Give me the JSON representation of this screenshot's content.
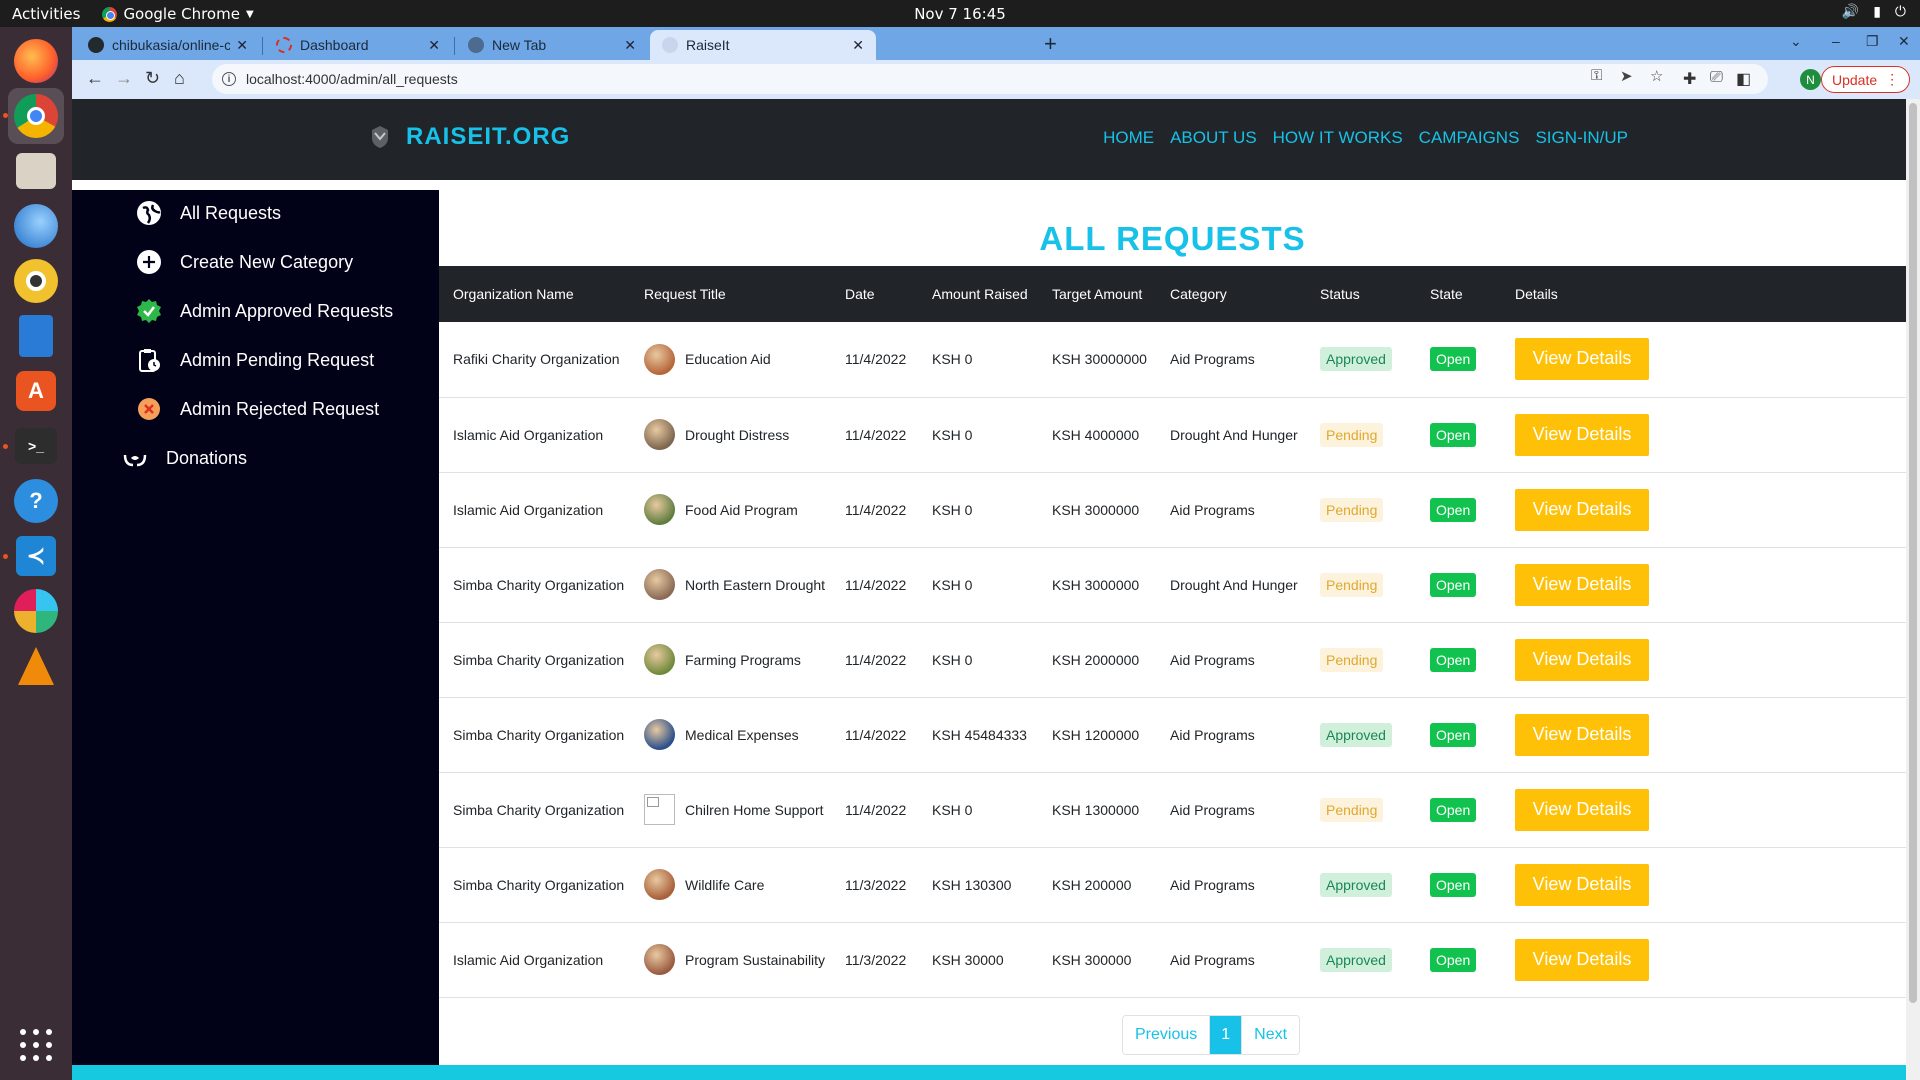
{
  "os_bar": {
    "activities": "Activities",
    "app_name": "Google Chrome",
    "clock": "Nov 7  16:45"
  },
  "browser": {
    "tabs": [
      {
        "title": "chibukasia/online-charity"
      },
      {
        "title": "Dashboard"
      },
      {
        "title": "New Tab"
      },
      {
        "title": "RaiseIt"
      }
    ],
    "active_tab_index": 3,
    "url": "localhost:4000/admin/all_requests",
    "profile_initial": "N",
    "update_label": "Update"
  },
  "site": {
    "brand": "RAISEIT.ORG",
    "nav": [
      "HOME",
      "ABOUT US",
      "HOW IT WORKS",
      "CAMPAIGNS",
      "SIGN-IN/UP"
    ]
  },
  "sidebar": {
    "items": [
      {
        "label": "All Requests",
        "icon": "globe-icon"
      },
      {
        "label": "Create New Category",
        "icon": "plus-circle-icon"
      },
      {
        "label": "Admin Approved Requests",
        "icon": "check-badge-icon"
      },
      {
        "label": "Admin Pending Request",
        "icon": "clipboard-clock-icon"
      },
      {
        "label": "Admin Rejected Request",
        "icon": "x-circle-icon"
      },
      {
        "label": "Donations",
        "icon": "donation-hands-icon"
      }
    ]
  },
  "main": {
    "title": "ALL REQUESTS",
    "columns": [
      "Organization Name",
      "Request Title",
      "Date",
      "Amount Raised",
      "Target Amount",
      "Category",
      "Status",
      "State",
      "Details"
    ],
    "rows": [
      {
        "org": "Rafiki Charity Organization",
        "title": "Education Aid",
        "date": "11/4/2022",
        "raised": "KSH 0",
        "target": "KSH 30000000",
        "category": "Aid Programs",
        "status": "Approved",
        "state": "Open",
        "action": "View Details",
        "img_color": "#b5653a"
      },
      {
        "org": "Islamic Aid Organization",
        "title": "Drought Distress",
        "date": "11/4/2022",
        "raised": "KSH 0",
        "target": "KSH 4000000",
        "category": "Drought And Hunger",
        "status": "Pending",
        "state": "Open",
        "action": "View Details",
        "img_color": "#7d6650"
      },
      {
        "org": "Islamic Aid Organization",
        "title": "Food Aid Program",
        "date": "11/4/2022",
        "raised": "KSH 0",
        "target": "KSH 3000000",
        "category": "Aid Programs",
        "status": "Pending",
        "state": "Open",
        "action": "View Details",
        "img_color": "#5f7d3f"
      },
      {
        "org": "Simba Charity Organization",
        "title": "North Eastern Drought",
        "date": "11/4/2022",
        "raised": "KSH 0",
        "target": "KSH 3000000",
        "category": "Drought And Hunger",
        "status": "Pending",
        "state": "Open",
        "action": "View Details",
        "img_color": "#8a6a55"
      },
      {
        "org": "Simba Charity Organization",
        "title": "Farming Programs",
        "date": "11/4/2022",
        "raised": "KSH 0",
        "target": "KSH 2000000",
        "category": "Aid Programs",
        "status": "Pending",
        "state": "Open",
        "action": "View Details",
        "img_color": "#6f8a3a"
      },
      {
        "org": "Simba Charity Organization",
        "title": "Medical Expenses",
        "date": "11/4/2022",
        "raised": "KSH 45484333",
        "target": "KSH 1200000",
        "category": "Aid Programs",
        "status": "Approved",
        "state": "Open",
        "action": "View Details",
        "img_color": "#2a4f8a"
      },
      {
        "org": "Simba Charity Organization",
        "title": "Chilren Home Support",
        "date": "11/4/2022",
        "raised": "KSH 0",
        "target": "KSH 1300000",
        "category": "Aid Programs",
        "status": "Pending",
        "state": "Open",
        "action": "View Details",
        "img_color": "broken"
      },
      {
        "org": "Simba Charity Organization",
        "title": "Wildlife Care",
        "date": "11/3/2022",
        "raised": "KSH 130300",
        "target": "KSH 200000",
        "category": "Aid Programs",
        "status": "Approved",
        "state": "Open",
        "action": "View Details",
        "img_color": "#a8603a"
      },
      {
        "org": "Islamic Aid Organization",
        "title": "Program Sustainability",
        "date": "11/3/2022",
        "raised": "KSH 30000",
        "target": "KSH 300000",
        "category": "Aid Programs",
        "status": "Approved",
        "state": "Open",
        "action": "View Details",
        "img_color": "#9a5a40"
      }
    ],
    "pagination": {
      "previous": "Previous",
      "current": "1",
      "next": "Next"
    }
  },
  "colors": {
    "accent": "#17c1e8",
    "header_bg": "#212529",
    "sidebar_bg": "#010118",
    "button": "#ffc107",
    "state_green": "#12c24f"
  }
}
